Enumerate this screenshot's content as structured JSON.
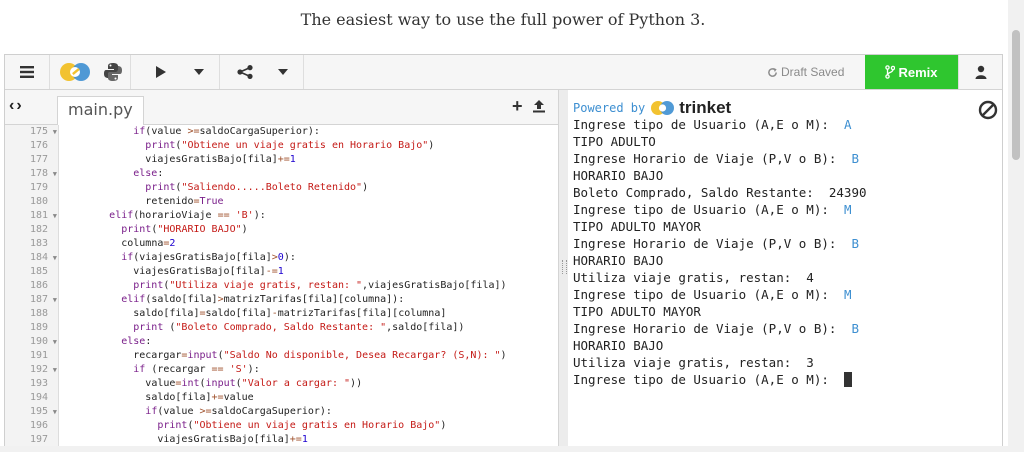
{
  "tagline": "The easiest way to use the full power of Python 3.",
  "toolbar": {
    "draft_status": "Draft Saved",
    "remix_label": "Remix"
  },
  "editor": {
    "filename": "main.py",
    "lines": [
      {
        "num": "175",
        "fold": true,
        "indent": "            ",
        "parts": [
          [
            "kw",
            "if"
          ],
          [
            "",
            "(value "
          ],
          [
            "op",
            ">="
          ],
          [
            "",
            "saldoCargaSuperior):"
          ]
        ]
      },
      {
        "num": "176",
        "fold": false,
        "indent": "              ",
        "parts": [
          [
            "kw",
            "print"
          ],
          [
            "",
            "("
          ],
          [
            "st",
            "\"Obtiene un viaje gratis en Horario Bajo\""
          ],
          [
            "",
            ")"
          ]
        ]
      },
      {
        "num": "177",
        "fold": false,
        "indent": "              ",
        "parts": [
          [
            "",
            "viajesGratisBajo[fila]"
          ],
          [
            "op",
            "+="
          ],
          [
            "nm",
            "1"
          ]
        ]
      },
      {
        "num": "178",
        "fold": true,
        "indent": "            ",
        "parts": [
          [
            "kw",
            "else"
          ],
          [
            "",
            ":"
          ]
        ]
      },
      {
        "num": "179",
        "fold": false,
        "indent": "              ",
        "parts": [
          [
            "kw",
            "print"
          ],
          [
            "",
            "("
          ],
          [
            "st",
            "\"Saliendo.....Boleto Retenido\""
          ],
          [
            "",
            ")"
          ]
        ]
      },
      {
        "num": "180",
        "fold": false,
        "indent": "              ",
        "parts": [
          [
            "",
            "retenido"
          ],
          [
            "op",
            "="
          ],
          [
            "kw",
            "True"
          ]
        ]
      },
      {
        "num": "181",
        "fold": true,
        "indent": "        ",
        "parts": [
          [
            "kw",
            "elif"
          ],
          [
            "",
            "(horarioViaje "
          ],
          [
            "op",
            "=="
          ],
          [
            "st",
            " 'B'"
          ],
          [
            "",
            "):"
          ]
        ]
      },
      {
        "num": "182",
        "fold": false,
        "indent": "          ",
        "parts": [
          [
            "kw",
            "print"
          ],
          [
            "",
            "("
          ],
          [
            "st",
            "\"HORARIO BAJO\""
          ],
          [
            "",
            ")"
          ]
        ]
      },
      {
        "num": "183",
        "fold": false,
        "indent": "          ",
        "parts": [
          [
            "",
            "columna"
          ],
          [
            "op",
            "="
          ],
          [
            "nm",
            "2"
          ]
        ]
      },
      {
        "num": "184",
        "fold": true,
        "indent": "          ",
        "parts": [
          [
            "kw",
            "if"
          ],
          [
            "",
            "(viajesGratisBajo[fila]"
          ],
          [
            "op",
            ">"
          ],
          [
            "nm",
            "0"
          ],
          [
            "",
            "):"
          ]
        ]
      },
      {
        "num": "185",
        "fold": false,
        "indent": "            ",
        "parts": [
          [
            "",
            "viajesGratisBajo[fila]"
          ],
          [
            "op",
            "-="
          ],
          [
            "nm",
            "1"
          ]
        ]
      },
      {
        "num": "186",
        "fold": false,
        "indent": "            ",
        "parts": [
          [
            "kw",
            "print"
          ],
          [
            "",
            "("
          ],
          [
            "st",
            "\"Utiliza viaje gratis, restan: \""
          ],
          [
            "",
            ",viajesGratisBajo[fila])"
          ]
        ]
      },
      {
        "num": "187",
        "fold": true,
        "indent": "          ",
        "parts": [
          [
            "kw",
            "elif"
          ],
          [
            "",
            "(saldo[fila]"
          ],
          [
            "op",
            ">"
          ],
          [
            "",
            "matrizTarifas[fila][columna]):"
          ]
        ]
      },
      {
        "num": "188",
        "fold": false,
        "indent": "            ",
        "parts": [
          [
            "",
            "saldo[fila]"
          ],
          [
            "op",
            "="
          ],
          [
            "",
            "saldo[fila]"
          ],
          [
            "op",
            "-"
          ],
          [
            "",
            "matrizTarifas[fila][columna]"
          ]
        ]
      },
      {
        "num": "189",
        "fold": false,
        "indent": "            ",
        "parts": [
          [
            "kw",
            "print"
          ],
          [
            "",
            " ("
          ],
          [
            "st",
            "\"Boleto Comprado, Saldo Restante: \""
          ],
          [
            "",
            ",saldo[fila])"
          ]
        ]
      },
      {
        "num": "190",
        "fold": true,
        "indent": "          ",
        "parts": [
          [
            "kw",
            "else"
          ],
          [
            "",
            ":"
          ]
        ]
      },
      {
        "num": "191",
        "fold": false,
        "indent": "            ",
        "parts": [
          [
            "",
            "recargar"
          ],
          [
            "op",
            "="
          ],
          [
            "kw",
            "input"
          ],
          [
            "",
            "("
          ],
          [
            "st",
            "\"Saldo No disponible, Desea Recargar? (S,N): \""
          ],
          [
            "",
            ")"
          ]
        ]
      },
      {
        "num": "192",
        "fold": true,
        "indent": "            ",
        "parts": [
          [
            "kw",
            "if"
          ],
          [
            "",
            " (recargar "
          ],
          [
            "op",
            "=="
          ],
          [
            "st",
            " 'S'"
          ],
          [
            "",
            "):"
          ]
        ]
      },
      {
        "num": "193",
        "fold": false,
        "indent": "              ",
        "parts": [
          [
            "",
            "value"
          ],
          [
            "op",
            "="
          ],
          [
            "kw",
            "int"
          ],
          [
            "",
            "("
          ],
          [
            "kw",
            "input"
          ],
          [
            "",
            "("
          ],
          [
            "st",
            "\"Valor a cargar: \""
          ],
          [
            "",
            "))"
          ]
        ]
      },
      {
        "num": "194",
        "fold": false,
        "indent": "              ",
        "parts": [
          [
            "",
            "saldo[fila]"
          ],
          [
            "op",
            "+="
          ],
          [
            "",
            "value"
          ]
        ]
      },
      {
        "num": "195",
        "fold": true,
        "indent": "              ",
        "parts": [
          [
            "kw",
            "if"
          ],
          [
            "",
            "(value "
          ],
          [
            "op",
            ">="
          ],
          [
            "",
            "saldoCargaSuperior):"
          ]
        ]
      },
      {
        "num": "196",
        "fold": false,
        "indent": "                ",
        "parts": [
          [
            "kw",
            "print"
          ],
          [
            "",
            "("
          ],
          [
            "st",
            "\"Obtiene un viaje gratis en Horario Bajo\""
          ],
          [
            "",
            ")"
          ]
        ]
      },
      {
        "num": "197",
        "fold": false,
        "indent": "                ",
        "parts": [
          [
            "",
            "viajesGratisBajo[fila]"
          ],
          [
            "op",
            "+="
          ],
          [
            "nm",
            "1"
          ]
        ]
      }
    ]
  },
  "console": {
    "powered_by": "Powered by",
    "brand": "trinket",
    "lines": [
      {
        "text": "Ingrese tipo de Usuario (A,E o M):  ",
        "input": "A"
      },
      {
        "text": "TIPO ADULTO",
        "input": ""
      },
      {
        "text": "Ingrese Horario de Viaje (P,V o B):  ",
        "input": "B"
      },
      {
        "text": "HORARIO BAJO",
        "input": ""
      },
      {
        "text": "Boleto Comprado, Saldo Restante:  24390",
        "input": ""
      },
      {
        "text": "Ingrese tipo de Usuario (A,E o M):  ",
        "input": "M"
      },
      {
        "text": "TIPO ADULTO MAYOR",
        "input": ""
      },
      {
        "text": "Ingrese Horario de Viaje (P,V o B):  ",
        "input": "B"
      },
      {
        "text": "HORARIO BAJO",
        "input": ""
      },
      {
        "text": "Utiliza viaje gratis, restan:  4",
        "input": ""
      },
      {
        "text": "Ingrese tipo de Usuario (A,E o M):  ",
        "input": "M"
      },
      {
        "text": "TIPO ADULTO MAYOR",
        "input": ""
      },
      {
        "text": "Ingrese Horario de Viaje (P,V o B):  ",
        "input": "B"
      },
      {
        "text": "HORARIO BAJO",
        "input": ""
      },
      {
        "text": "Utiliza viaje gratis, restan:  3",
        "input": ""
      }
    ],
    "prompt": "Ingrese tipo de Usuario (A,E o M): "
  },
  "colors": {
    "remix_green": "#2fc62f",
    "console_input_blue": "#3d8fd1"
  },
  "icons": [
    "menu-icon",
    "trinket-logo-icon",
    "python-logo-icon",
    "run-icon",
    "chevron-down-icon",
    "share-icon",
    "refresh-icon",
    "remix-icon",
    "user-icon",
    "back-icon",
    "forward-icon",
    "add-file-icon",
    "upload-icon",
    "clear-console-icon"
  ]
}
